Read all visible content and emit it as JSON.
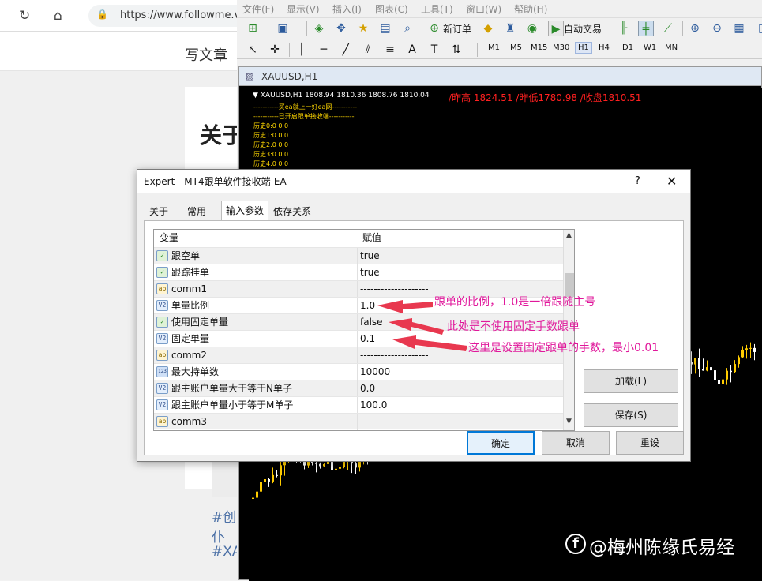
{
  "browser": {
    "url": "https://www.followme.v",
    "write_article": "写文章",
    "heading_fragment": "关于",
    "tags": [
      "#创仆",
      "#XA"
    ]
  },
  "mt4": {
    "menu": [
      "文件(F)",
      "显示(V)",
      "插入(I)",
      "图表(C)",
      "工具(T)",
      "窗口(W)",
      "帮助(H)"
    ],
    "toolbar": {
      "new_order": "新订单",
      "auto_trading": "自动交易"
    },
    "timeframes": [
      "M1",
      "M5",
      "M15",
      "M30",
      "H1",
      "H4",
      "D1",
      "W1",
      "MN"
    ],
    "active_timeframe": "H1",
    "chart": {
      "window_title": "XAUUSD,H1",
      "ohlc_line": "XAUUSD,H1  1808.94 1810.36 1808.76 1810.04",
      "hlc_line": "/昨高 1824.51 /昨低1780.98 /收盘1810.51",
      "info_lines": [
        "-----------买ea就上一好ea网-----------",
        "-----------已开启跟单接收端-----------",
        "历史0:0  0 0",
        "历史1:0  0 0",
        "历史2:0  0 0",
        "历史3:0  0 0",
        "历史4:0  0 0"
      ],
      "up_color": "#ffcc00",
      "down_color": "#ffffff"
    }
  },
  "dialog": {
    "title": "Expert - MT4跟单软件接收端-EA",
    "help": "?",
    "close": "✕",
    "tabs": [
      "关于",
      "常用",
      "输入参数",
      "依存关系"
    ],
    "active_tab": "输入参数",
    "columns": {
      "variable": "变量",
      "value": "赋值"
    },
    "rows": [
      {
        "icon": "bool",
        "name": "跟空单",
        "value": "true"
      },
      {
        "icon": "bool",
        "name": "跟踪挂单",
        "value": "true"
      },
      {
        "icon": "ab",
        "name": "comm1",
        "value": "--------------------"
      },
      {
        "icon": "v2",
        "name": "单量比例",
        "value": "1.0"
      },
      {
        "icon": "bool",
        "name": "使用固定单量",
        "value": "false"
      },
      {
        "icon": "v2",
        "name": "固定单量",
        "value": "0.1"
      },
      {
        "icon": "ab",
        "name": "comm2",
        "value": "--------------------"
      },
      {
        "icon": "123",
        "name": "最大持单数",
        "value": "10000"
      },
      {
        "icon": "v2",
        "name": "跟主账户单量大于等于N单子",
        "value": "0.0"
      },
      {
        "icon": "v2",
        "name": "跟主账户单量小于等于M单子",
        "value": "100.0"
      },
      {
        "icon": "ab",
        "name": "comm3",
        "value": "--------------------"
      }
    ],
    "buttons": {
      "load": "加载(L)",
      "save": "保存(S)",
      "ok": "确定",
      "cancel": "取消",
      "reset": "重设"
    }
  },
  "annotations": [
    "跟单的比例，1.0是一倍跟随主号",
    "此处是不使用固定手数跟单",
    "这里是设置固定跟单的手数，最小0.01"
  ],
  "annotation_color": "#e0189b",
  "watermark": "@梅州陈缘氏易经"
}
